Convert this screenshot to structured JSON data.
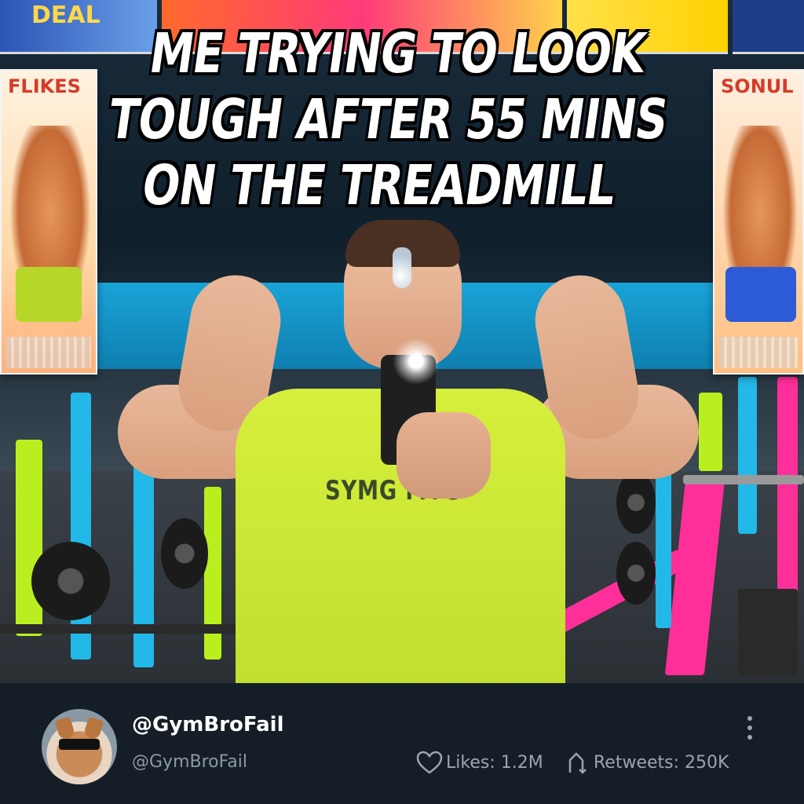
{
  "meme": {
    "caption_lines": [
      "ME TRYING TO LOOK",
      "TOUGH AFTER 55 MINS",
      "ON THE TREADMILL"
    ],
    "shirt_text": "SYMG MYG",
    "poster_left_title": "FLIKES",
    "poster_right_title": "SONUL",
    "banner_text": "DEAL"
  },
  "post": {
    "display_name": "@GymBroFail",
    "handle": "@GymBroFail",
    "likes_label": "Likes: 1.2M",
    "retweets_label": "Retweets: 250K",
    "more_icon": "vertical-ellipsis-icon",
    "like_icon": "heart-icon",
    "retweet_icon": "retweet-icon"
  },
  "colors": {
    "footer_bg": "#151d27",
    "muted_text": "#9aa5b1",
    "shirt": "#d6ef3c",
    "equipment_cyan": "#22b8e8",
    "equipment_pink": "#ff2f9a",
    "equipment_lime": "#b9ef1f"
  }
}
